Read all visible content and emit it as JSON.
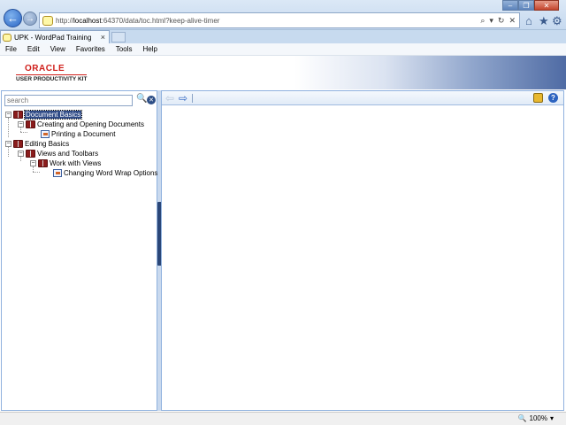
{
  "browser": {
    "url_prefix": "http://",
    "url_host": "localhost",
    "url_rest": ":64370/data/toc.html?keep-alive-timer",
    "tab_title": "UPK - WordPad Training",
    "tab_close": "×",
    "addr_tools": [
      "⌕",
      "▾",
      "↻",
      "✕"
    ],
    "window_controls": [
      "–",
      "❐",
      "✕"
    ],
    "right_icons": [
      "⌂",
      "★",
      "⚙"
    ],
    "menu": [
      "File",
      "Edit",
      "View",
      "Favorites",
      "Tools",
      "Help"
    ]
  },
  "banner": {
    "oracle": "ORACLE",
    "upk": "USER PRODUCTIVITY KIT"
  },
  "outline": {
    "search_placeholder": "search",
    "items": [
      {
        "label": "Document Basics",
        "type": "book",
        "toggle": "⊟"
      },
      {
        "label": "Creating and Opening Documents",
        "type": "book",
        "toggle": "⊟"
      },
      {
        "label": "Printing a Document",
        "type": "topic"
      },
      {
        "label": "Editing Basics",
        "type": "book",
        "toggle": "⊟"
      },
      {
        "label": "Views and Toolbars",
        "type": "book",
        "toggle": "⊟"
      },
      {
        "label": "Work with Views",
        "type": "book",
        "toggle": "⊟"
      },
      {
        "label": "Changing Word Wrap Options",
        "type": "topic"
      }
    ]
  },
  "toolbar": {
    "back_arrow": "⇦",
    "forward_arrow": "⇨",
    "help_label": "?"
  },
  "status": {
    "zoom": "100%",
    "zoom_arrow": "▾"
  },
  "colors": {
    "selection": "#2e4a86",
    "pane_border": "#8fb1de",
    "oracle_red": "#d0201c"
  }
}
